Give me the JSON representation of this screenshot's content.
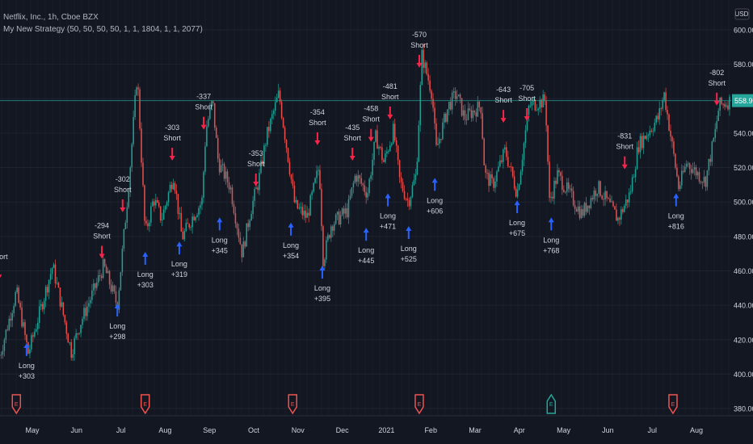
{
  "header": {
    "symbol_line": "Netflix, Inc., 1h, Cboe BZX",
    "indicator_line": "My New Strategy (50, 50, 50, 50, 1, 1, 1804, 1, 1, 2077)"
  },
  "colors": {
    "background": "#131722",
    "grid": "#1f2331",
    "up": "#26a69a",
    "down": "#ef5350",
    "long": "#2962ff",
    "short": "#f7254a",
    "price_line": "#26a69a",
    "text": "#d1d4dc"
  },
  "chart_data": {
    "type": "candlestick",
    "title": "Netflix, Inc., 1h, Cboe BZX",
    "currency": "USD",
    "last_price": "558.90",
    "last_price_value": 558.9,
    "ylim": [
      370,
      610
    ],
    "y_ticks": [
      "380.00",
      "400.00",
      "420.00",
      "440.00",
      "460.00",
      "480.00",
      "500.00",
      "520.00",
      "540.00",
      "560.00",
      "580.00",
      "600.00"
    ],
    "x_ticks": [
      "May",
      "Jun",
      "Jul",
      "Aug",
      "Sep",
      "Oct",
      "Nov",
      "Dec",
      "2021",
      "Feb",
      "Mar",
      "Apr",
      "May",
      "Jun",
      "Jul",
      "Aug"
    ],
    "x_unit": "months since May 2020 (approx.)",
    "price_path": [
      [
        -0.73,
        411
      ],
      [
        -0.36,
        448
      ],
      [
        -0.09,
        412
      ],
      [
        0.46,
        463
      ],
      [
        0.88,
        413
      ],
      [
        1.09,
        430
      ],
      [
        1.46,
        453
      ],
      [
        1.61,
        463
      ],
      [
        1.92,
        440
      ],
      [
        2.19,
        514
      ],
      [
        2.37,
        575
      ],
      [
        2.55,
        481
      ],
      [
        2.74,
        502
      ],
      [
        2.92,
        490
      ],
      [
        3.19,
        516
      ],
      [
        3.38,
        479
      ],
      [
        3.65,
        493
      ],
      [
        3.83,
        500
      ],
      [
        3.92,
        542
      ],
      [
        4.07,
        559
      ],
      [
        4.2,
        523
      ],
      [
        4.47,
        509
      ],
      [
        4.74,
        470
      ],
      [
        4.93,
        495
      ],
      [
        5.11,
        512
      ],
      [
        5.29,
        538
      ],
      [
        5.57,
        563
      ],
      [
        5.75,
        531
      ],
      [
        5.93,
        498
      ],
      [
        6.2,
        491
      ],
      [
        6.48,
        521
      ],
      [
        6.57,
        466
      ],
      [
        6.75,
        487
      ],
      [
        7.12,
        495
      ],
      [
        7.3,
        516
      ],
      [
        7.57,
        505
      ],
      [
        7.76,
        538
      ],
      [
        7.94,
        523
      ],
      [
        8.16,
        542
      ],
      [
        8.3,
        512
      ],
      [
        8.49,
        500
      ],
      [
        8.67,
        516
      ],
      [
        8.8,
        585
      ],
      [
        9.03,
        563
      ],
      [
        9.12,
        530
      ],
      [
        9.4,
        556
      ],
      [
        9.58,
        563
      ],
      [
        9.76,
        549
      ],
      [
        10.13,
        556
      ],
      [
        10.22,
        516
      ],
      [
        10.4,
        510
      ],
      [
        10.68,
        530
      ],
      [
        10.95,
        505
      ],
      [
        11.22,
        556
      ],
      [
        11.59,
        559
      ],
      [
        11.68,
        500
      ],
      [
        11.86,
        516
      ],
      [
        12.41,
        493
      ],
      [
        12.77,
        509
      ],
      [
        13.23,
        490
      ],
      [
        13.5,
        505
      ],
      [
        13.69,
        533
      ],
      [
        14.14,
        549
      ],
      [
        14.27,
        563
      ],
      [
        14.42,
        538
      ],
      [
        14.6,
        508
      ],
      [
        14.78,
        523
      ],
      [
        15.2,
        512
      ],
      [
        15.42,
        540
      ],
      [
        15.51,
        556
      ],
      [
        15.78,
        559
      ]
    ],
    "signals": [
      {
        "side": "short",
        "label": "Short",
        "pnl": "",
        "m": -0.75,
        "price": 455
      },
      {
        "side": "long",
        "label": "Long",
        "pnl": "+303",
        "m": -0.13,
        "price": 418
      },
      {
        "side": "short",
        "label": "Short",
        "pnl": "-294",
        "m": 1.57,
        "price": 467
      },
      {
        "side": "long",
        "label": "Long",
        "pnl": "+298",
        "m": 1.92,
        "price": 441
      },
      {
        "side": "short",
        "label": "Short",
        "pnl": "-302",
        "m": 2.04,
        "price": 494
      },
      {
        "side": "long",
        "label": "Long",
        "pnl": "+303",
        "m": 2.55,
        "price": 471
      },
      {
        "side": "short",
        "label": "Short",
        "pnl": "-303",
        "m": 3.16,
        "price": 524
      },
      {
        "side": "long",
        "label": "Long",
        "pnl": "+319",
        "m": 3.32,
        "price": 477
      },
      {
        "side": "short",
        "label": "Short",
        "pnl": "-337",
        "m": 3.87,
        "price": 542
      },
      {
        "side": "long",
        "label": "Long",
        "pnl": "+345",
        "m": 4.23,
        "price": 491
      },
      {
        "side": "short",
        "label": "Short",
        "pnl": "-353",
        "m": 5.05,
        "price": 509
      },
      {
        "side": "long",
        "label": "Long",
        "pnl": "+354",
        "m": 5.84,
        "price": 488
      },
      {
        "side": "short",
        "label": "Short",
        "pnl": "-354",
        "m": 6.44,
        "price": 533
      },
      {
        "side": "long",
        "label": "Long",
        "pnl": "+395",
        "m": 6.55,
        "price": 463
      },
      {
        "side": "short",
        "label": "Short",
        "pnl": "-435",
        "m": 7.23,
        "price": 524
      },
      {
        "side": "long",
        "label": "Long",
        "pnl": "+445",
        "m": 7.54,
        "price": 485
      },
      {
        "side": "short",
        "label": "Short",
        "pnl": "-458",
        "m": 7.65,
        "price": 535
      },
      {
        "side": "long",
        "label": "Long",
        "pnl": "+471",
        "m": 8.03,
        "price": 505
      },
      {
        "side": "short",
        "label": "Short",
        "pnl": "-481",
        "m": 8.08,
        "price": 548
      },
      {
        "side": "long",
        "label": "Long",
        "pnl": "+525",
        "m": 8.5,
        "price": 486
      },
      {
        "side": "short",
        "label": "Short",
        "pnl": "-570",
        "m": 8.74,
        "price": 578
      },
      {
        "side": "long",
        "label": "Long",
        "pnl": "+606",
        "m": 9.09,
        "price": 514
      },
      {
        "side": "short",
        "label": "Short",
        "pnl": "-643",
        "m": 10.64,
        "price": 546
      },
      {
        "side": "long",
        "label": "Long",
        "pnl": "+675",
        "m": 10.95,
        "price": 501
      },
      {
        "side": "short",
        "label": "Short",
        "pnl": "-705",
        "m": 11.17,
        "price": 547
      },
      {
        "side": "long",
        "label": "Long",
        "pnl": "+768",
        "m": 11.72,
        "price": 491
      },
      {
        "side": "short",
        "label": "Short",
        "pnl": "-831",
        "m": 13.38,
        "price": 519
      },
      {
        "side": "long",
        "label": "Long",
        "pnl": "+816",
        "m": 14.54,
        "price": 505
      },
      {
        "side": "short",
        "label": "Short",
        "pnl": "-802",
        "m": 15.46,
        "price": 556
      }
    ],
    "earnings": [
      {
        "m": -0.36,
        "kind": "miss",
        "letter": "E"
      },
      {
        "m": 2.55,
        "kind": "miss",
        "letter": "E"
      },
      {
        "m": 5.88,
        "kind": "miss",
        "letter": "E"
      },
      {
        "m": 8.74,
        "kind": "miss",
        "letter": "E"
      },
      {
        "m": 11.72,
        "kind": "beat",
        "letter": "E"
      },
      {
        "m": 14.47,
        "kind": "miss",
        "letter": "E"
      }
    ]
  }
}
